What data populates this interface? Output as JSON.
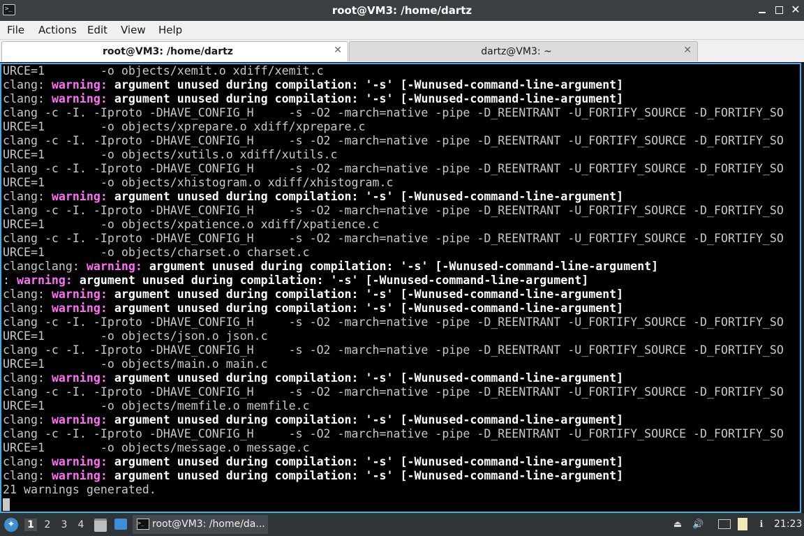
{
  "window": {
    "title": "root@VM3: /home/dartz",
    "app_icon": "terminal-icon",
    "buttons": [
      "minimize-icon",
      "maximize-icon",
      "close-icon"
    ]
  },
  "menu": [
    "File",
    "Actions",
    "Edit",
    "View",
    "Help"
  ],
  "tabs": [
    {
      "label": "root@VM3: /home/dartz",
      "active": true
    },
    {
      "label": "dartz@VM3: ~",
      "active": false
    }
  ],
  "terminal": {
    "lines": [
      {
        "text": "URCE=1        -o objects/xemit.o xdiff/xemit.c"
      },
      {
        "pre": "clang: ",
        "warn": "warning:",
        "msg": " argument unused during compilation: '-s' [-Wunused-command-line-argument]"
      },
      {
        "pre": "clang: ",
        "warn": "warning:",
        "msg": " argument unused during compilation: '-s' [-Wunused-command-line-argument]"
      },
      {
        "text": "clang -c -I. -Iproto -DHAVE_CONFIG_H     -s -O2 -march=native -pipe -D_REENTRANT -U_FORTIFY_SOURCE -D_FORTIFY_SO"
      },
      {
        "text": "URCE=1        -o objects/xprepare.o xdiff/xprepare.c"
      },
      {
        "text": "clang -c -I. -Iproto -DHAVE_CONFIG_H     -s -O2 -march=native -pipe -D_REENTRANT -U_FORTIFY_SOURCE -D_FORTIFY_SO"
      },
      {
        "text": "URCE=1        -o objects/xutils.o xdiff/xutils.c"
      },
      {
        "text": "clang -c -I. -Iproto -DHAVE_CONFIG_H     -s -O2 -march=native -pipe -D_REENTRANT -U_FORTIFY_SOURCE -D_FORTIFY_SO"
      },
      {
        "text": "URCE=1        -o objects/xhistogram.o xdiff/xhistogram.c"
      },
      {
        "pre": "clang: ",
        "warn": "warning:",
        "msg": " argument unused during compilation: '-s' [-Wunused-command-line-argument]"
      },
      {
        "text": "clang -c -I. -Iproto -DHAVE_CONFIG_H     -s -O2 -march=native -pipe -D_REENTRANT -U_FORTIFY_SOURCE -D_FORTIFY_SO"
      },
      {
        "text": "URCE=1        -o objects/xpatience.o xdiff/xpatience.c"
      },
      {
        "text": "clang -c -I. -Iproto -DHAVE_CONFIG_H     -s -O2 -march=native -pipe -D_REENTRANT -U_FORTIFY_SOURCE -D_FORTIFY_SO"
      },
      {
        "text": "URCE=1        -o objects/charset.o charset.c"
      },
      {
        "pre": "clangclang: ",
        "warn": "warning:",
        "msg": " argument unused during compilation: '-s' [-Wunused-command-line-argument]"
      },
      {
        "pre": ": ",
        "warn": "warning:",
        "msg": " argument unused during compilation: '-s' [-Wunused-command-line-argument]"
      },
      {
        "pre": "clang: ",
        "warn": "warning:",
        "msg": " argument unused during compilation: '-s' [-Wunused-command-line-argument]"
      },
      {
        "pre": "clang: ",
        "warn": "warning:",
        "msg": " argument unused during compilation: '-s' [-Wunused-command-line-argument]"
      },
      {
        "text": "clang -c -I. -Iproto -DHAVE_CONFIG_H     -s -O2 -march=native -pipe -D_REENTRANT -U_FORTIFY_SOURCE -D_FORTIFY_SO"
      },
      {
        "text": "URCE=1        -o objects/json.o json.c"
      },
      {
        "text": "clang -c -I. -Iproto -DHAVE_CONFIG_H     -s -O2 -march=native -pipe -D_REENTRANT -U_FORTIFY_SOURCE -D_FORTIFY_SO"
      },
      {
        "text": "URCE=1        -o objects/main.o main.c"
      },
      {
        "pre": "clang: ",
        "warn": "warning:",
        "msg": " argument unused during compilation: '-s' [-Wunused-command-line-argument]"
      },
      {
        "text": "clang -c -I. -Iproto -DHAVE_CONFIG_H     -s -O2 -march=native -pipe -D_REENTRANT -U_FORTIFY_SOURCE -D_FORTIFY_SO"
      },
      {
        "text": "URCE=1        -o objects/memfile.o memfile.c"
      },
      {
        "pre": "clang: ",
        "warn": "warning:",
        "msg": " argument unused during compilation: '-s' [-Wunused-command-line-argument]"
      },
      {
        "text": "clang -c -I. -Iproto -DHAVE_CONFIG_H     -s -O2 -march=native -pipe -D_REENTRANT -U_FORTIFY_SOURCE -D_FORTIFY_SO"
      },
      {
        "text": "URCE=1        -o objects/message.o message.c"
      },
      {
        "pre": "clang: ",
        "warn": "warning:",
        "msg": " argument unused during compilation: '-s' [-Wunused-command-line-argument]"
      },
      {
        "pre": "clang: ",
        "warn": "warning:",
        "msg": " argument unused during compilation: '-s' [-Wunused-command-line-argument]"
      },
      {
        "text": "21 warnings generated."
      }
    ],
    "warning_color": "#ff6ff6",
    "text_color": "#c8c8c8"
  },
  "taskbar": {
    "start_icon": "lxqt-start-icon",
    "workspaces": [
      "1",
      "2",
      "3",
      "4"
    ],
    "active_workspace": "1",
    "quicklaunch": [
      "file-manager-icon",
      "desktop-icon"
    ],
    "task": {
      "label": "root@VM3: /home/da...",
      "icon": "terminal-icon"
    },
    "tray": [
      "eject-icon",
      "volume-icon",
      "network-icon",
      "clipboard-icon",
      "notification-icon"
    ],
    "clock": "21:23"
  }
}
